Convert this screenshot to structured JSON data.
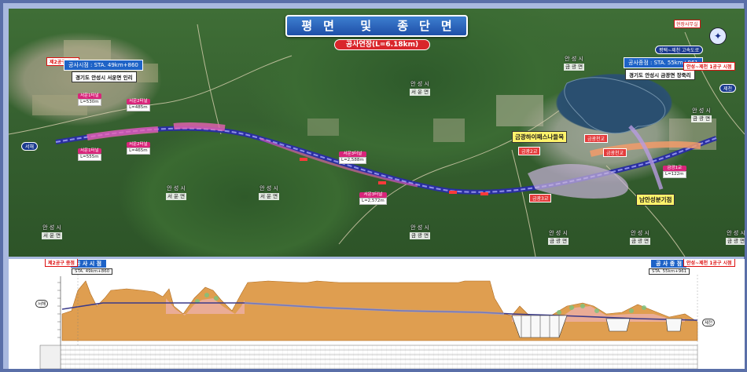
{
  "title": "평면 및 종단면도",
  "subtitle": "공사연장(L=6.18km)",
  "start": {
    "sta_label": "공사시점 : STA. 49km+860",
    "tag": "제2공구 종점",
    "address": "경기도 안성시 서운면 인리"
  },
  "end": {
    "sta_label": "공사종점 : STA. 55km+961",
    "tag": "평택~제천 고속도로",
    "tag2": "안성~제천 1공구 시점",
    "address": "경기도 안성시 금광면 장죽리"
  },
  "office": "현장사무실",
  "roads_left": "서해",
  "roads_right": "제천",
  "pois": {
    "rest_area": "금광하이패스나들목",
    "branch": "남안성분기점"
  },
  "towns": [
    {
      "city": "안 성 시",
      "district": "서 운 면"
    },
    {
      "city": "안 성 시",
      "district": "서 운 면"
    },
    {
      "city": "안 성 시",
      "district": "서 운 면"
    },
    {
      "city": "안 성 시",
      "district": "서 운 면"
    },
    {
      "city": "안 성 시",
      "district": "금 광 면"
    },
    {
      "city": "안 성 시",
      "district": "금 광 면"
    },
    {
      "city": "안 성 시",
      "district": "금 광 면"
    },
    {
      "city": "안 성 시",
      "district": "금 광 면"
    },
    {
      "city": "안 성 시",
      "district": "금 광 면"
    },
    {
      "city": "안 성 시",
      "district": "금 광 면"
    }
  ],
  "tunnels": [
    {
      "name": "서운1터널",
      "len": "L=530m"
    },
    {
      "name": "서운2터널",
      "len": "L=485m"
    },
    {
      "name": "서운1터널",
      "len": "L=555m"
    },
    {
      "name": "서운2터널",
      "len": "L=465m"
    },
    {
      "name": "서운3터널",
      "len": "L=2,588m"
    },
    {
      "name": "서운3터널",
      "len": "L=2,572m"
    },
    {
      "name": "금광1교",
      "len": "L=122m"
    }
  ],
  "labels_red": [
    "금광2교",
    "금광천교",
    "금광3교",
    "금광천교"
  ],
  "profile": {
    "start_tag": "공 사 시 점",
    "end_tag": "공 사 종 점",
    "start_sta": "STA. 49km+860",
    "end_sta": "STA. 55km+961",
    "left_label": "서해",
    "right_label": "제천",
    "start_side": "제2공구 종점",
    "end_side": "안성~제천 1공구 시점"
  }
}
